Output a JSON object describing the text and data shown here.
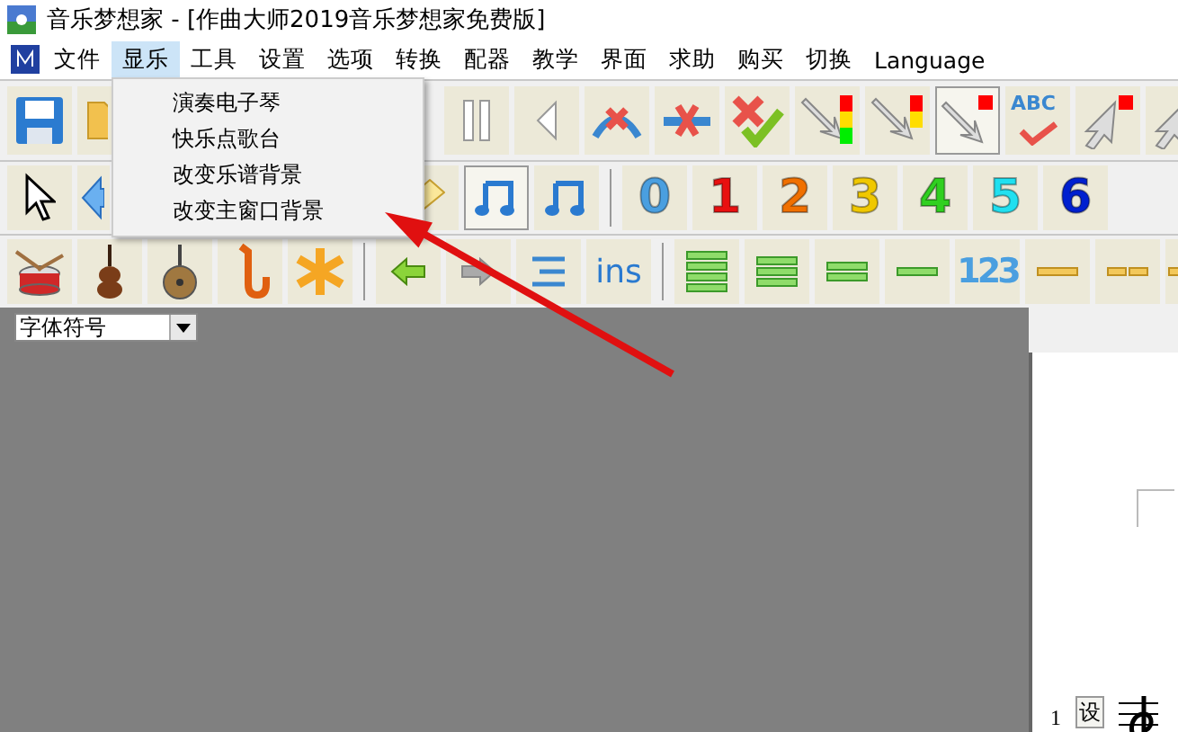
{
  "window": {
    "title": "音乐梦想家 - [作曲大师2019音乐梦想家免费版]"
  },
  "menu": [
    {
      "label": "文件",
      "selected": false
    },
    {
      "label": "显乐",
      "selected": true
    },
    {
      "label": "工具",
      "selected": false
    },
    {
      "label": "设置",
      "selected": false
    },
    {
      "label": "选项",
      "selected": false
    },
    {
      "label": "转换",
      "selected": false
    },
    {
      "label": "配器",
      "selected": false
    },
    {
      "label": "教学",
      "selected": false
    },
    {
      "label": "界面",
      "selected": false
    },
    {
      "label": "求助",
      "selected": false
    },
    {
      "label": "购买",
      "selected": false
    },
    {
      "label": "切换",
      "selected": false
    },
    {
      "label": "Language",
      "selected": false
    }
  ],
  "dropdown": [
    "演奏电子琴",
    "快乐点歌台",
    "改变乐谱背景",
    "改变主窗口背景"
  ],
  "toolbar_text": {
    "abc": "ABC",
    "ins": "ins",
    "count": "123"
  },
  "digits": [
    {
      "label": "0",
      "color": "#4a9fe0"
    },
    {
      "label": "1",
      "color": "#e81010"
    },
    {
      "label": "2",
      "color": "#f07000"
    },
    {
      "label": "3",
      "color": "#f0c800"
    },
    {
      "label": "4",
      "color": "#30d020"
    },
    {
      "label": "5",
      "color": "#20e0f0"
    },
    {
      "label": "6",
      "color": "#0020d0"
    }
  ],
  "font_combo": {
    "value": "字体符号"
  },
  "score": {
    "measure_number": "1",
    "set_button": "设"
  }
}
